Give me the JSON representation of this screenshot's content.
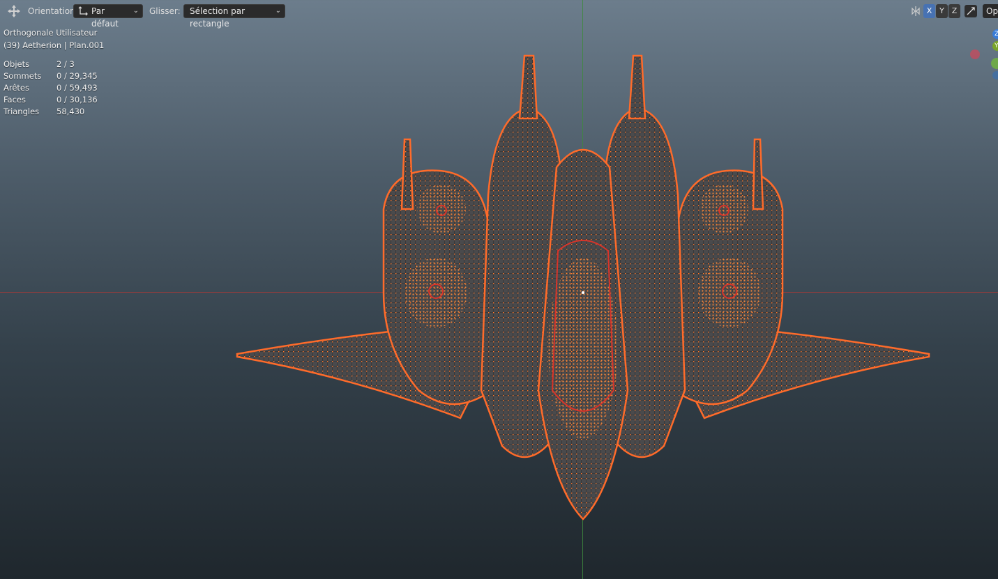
{
  "header": {
    "orientation_label": "Orientation:",
    "orientation_value": "Par défaut",
    "glisser_label": "Glisser:",
    "glisser_value": "Sélection par rectangle",
    "axes": [
      "X",
      "Y",
      "Z"
    ],
    "options_label": "Opt"
  },
  "overlay": {
    "view_name": "Orthogonale Utilisateur",
    "object_info": "(39) Aetherion | Plan.001",
    "stats": [
      {
        "label": "Objets",
        "value": "2 / 3"
      },
      {
        "label": "Sommets",
        "value": "0 / 29,345"
      },
      {
        "label": "Arêtes",
        "value": "0 / 59,493"
      },
      {
        "label": "Faces",
        "value": "0 / 30,136"
      },
      {
        "label": "Triangles",
        "value": "58,430"
      }
    ]
  },
  "gizmo": {
    "labels": [
      "Z",
      "Y"
    ]
  },
  "colors": {
    "mesh_orange": "#ff7a2e",
    "mesh_red": "#d8342a",
    "x_axis": "#a53a3a",
    "y_axis": "#3e8a3e",
    "active_axis": "#4772b3"
  }
}
